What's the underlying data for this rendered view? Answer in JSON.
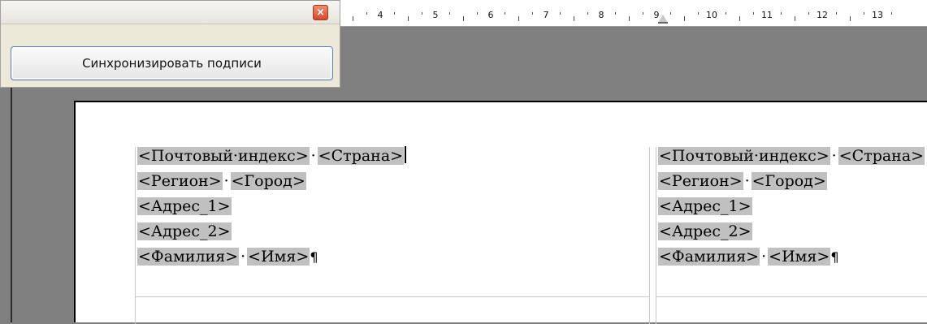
{
  "ruler": {
    "labels": [
      "4",
      "5",
      "6",
      "7",
      "8",
      "9",
      "10",
      "11",
      "12",
      "13"
    ]
  },
  "panel": {
    "close_label": "×",
    "sync_button_label": "Синхронизировать подписи"
  },
  "labels": [
    {
      "lines": [
        {
          "fields": [
            "<Почтовый·индекс>",
            "<Страна>"
          ],
          "end": "cursor"
        },
        {
          "fields": [
            "<Регион>",
            "<Город>"
          ]
        },
        {
          "fields": [
            "<Адрес_1>"
          ]
        },
        {
          "fields": [
            "<Адрес_2>"
          ]
        },
        {
          "fields": [
            "<Фамилия>",
            "<Имя>"
          ],
          "end": "pilcrow"
        }
      ]
    },
    {
      "lines": [
        {
          "fields": [
            "<Почтовый·индекс>",
            "<Страна>"
          ]
        },
        {
          "fields": [
            "<Регион>",
            "<Город>"
          ]
        },
        {
          "fields": [
            "<Адрес_1>"
          ]
        },
        {
          "fields": [
            "<Адрес_2>"
          ]
        },
        {
          "fields": [
            "<Фамилия>",
            "<Имя>"
          ],
          "end": "pilcrow"
        }
      ]
    }
  ],
  "separator": "·",
  "pilcrow": "¶",
  "colors": {
    "field_shading": "#c0c0c0",
    "workspace": "#808080",
    "close_button": "#d44a2a"
  }
}
